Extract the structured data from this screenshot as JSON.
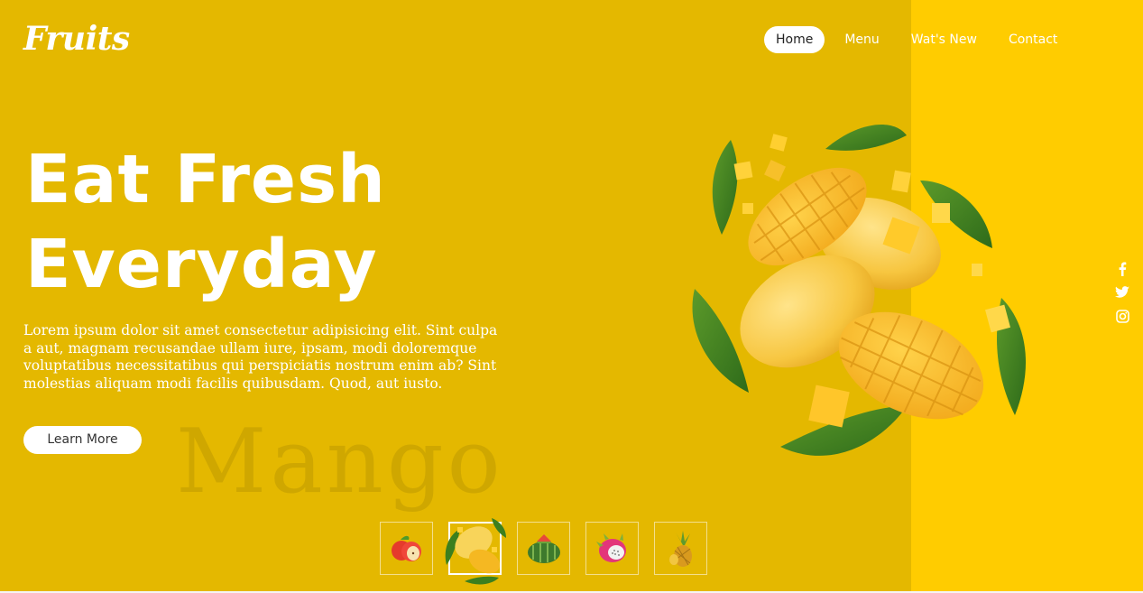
{
  "brand": {
    "logo": "Fruits"
  },
  "nav": {
    "items": [
      "Home",
      "Menu",
      "Wat's New",
      "Contact"
    ],
    "active_index": 0
  },
  "hero": {
    "title_line1": "Eat Fresh",
    "title_line2": "Everyday",
    "body": "Lorem ipsum dolor sit amet consectetur adipisicing elit. Sint culpa a aut, magnam recusandae ullam iure, ipsam, modi doloremque voluptatibus necessitatibus qui perspiciatis nostrum enim ab? Sint molestias aliquam modi facilis quibusdam. Quod, aut iusto.",
    "button": "Learn More",
    "watermark": "Mango"
  },
  "social": [
    "facebook-icon",
    "twitter-icon",
    "instagram-icon"
  ],
  "thumbnails": [
    {
      "fruit": "apple",
      "icon": "apple-icon"
    },
    {
      "fruit": "mango",
      "icon": "mango-icon",
      "active": true
    },
    {
      "fruit": "watermelon",
      "icon": "watermelon-icon"
    },
    {
      "fruit": "dragon fruit",
      "icon": "dragon-fruit-icon"
    },
    {
      "fruit": "pineapple",
      "icon": "pineapple-icon"
    }
  ],
  "colors": {
    "panel": "#E4B800",
    "accent": "#FFCC00",
    "text": "#FFFFFF"
  }
}
